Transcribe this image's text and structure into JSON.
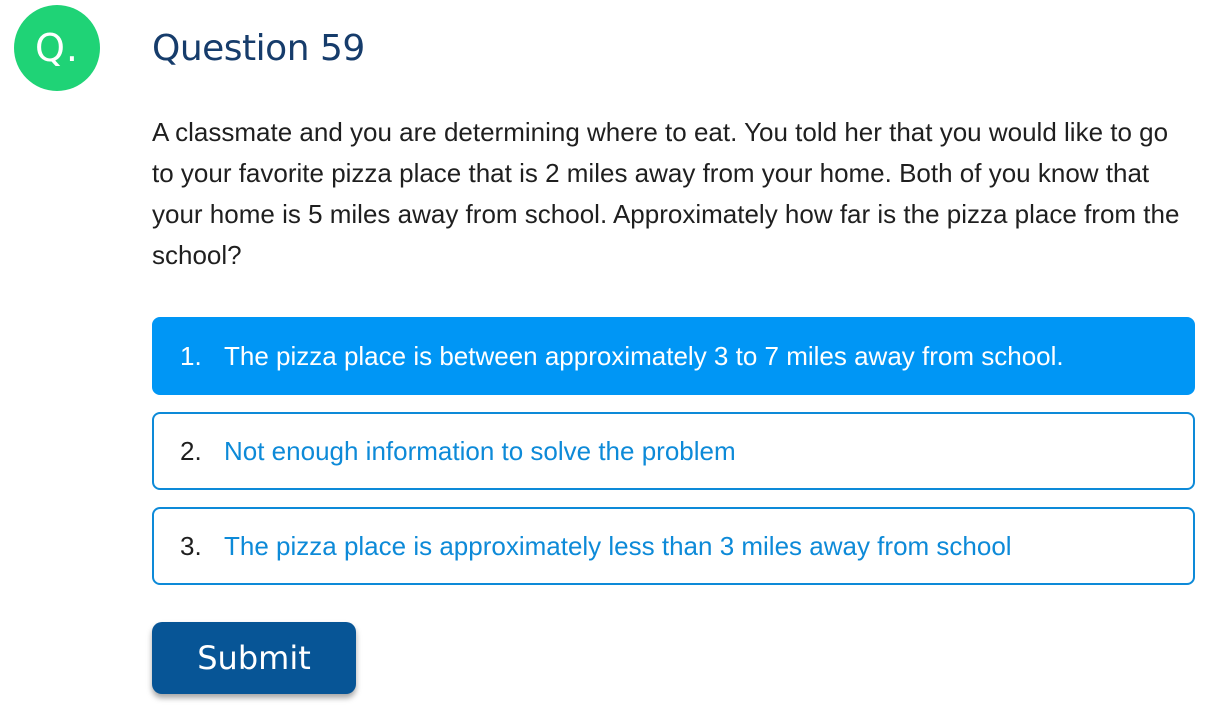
{
  "badge": {
    "text": "Q."
  },
  "question": {
    "title": "Question 59",
    "text": "A classmate and you are determining where to eat. You told her that you would like to go to your favorite pizza place that is 2 miles away from your home. Both of you know that your home is 5 miles away from school. Approximately how far is the pizza place from the school?"
  },
  "options": [
    {
      "number": "1.",
      "label": "The pizza place is between approximately 3 to 7 miles away from school.",
      "selected": true
    },
    {
      "number": "2.",
      "label": "Not enough information to solve the problem",
      "selected": false
    },
    {
      "number": "3.",
      "label": "The pizza place is approximately less than 3 miles away from school",
      "selected": false
    }
  ],
  "submit": {
    "label": "Submit"
  },
  "colors": {
    "badge": "#1fd376",
    "title": "#163c6b",
    "option_accent": "#0d8ad8",
    "selected_bg": "#0096f5",
    "submit_bg": "#075596"
  }
}
